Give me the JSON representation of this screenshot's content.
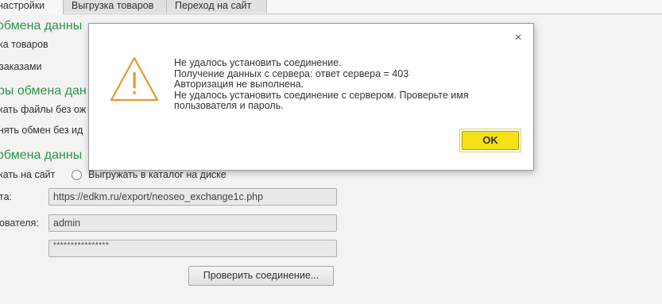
{
  "tabs": [
    {
      "label": "настройки"
    },
    {
      "label": "Выгрузка товаров"
    },
    {
      "label": "Переход на сайт"
    }
  ],
  "background": {
    "section1_title": "обмена данны",
    "section1_item1": "ка товаров",
    "section1_item2": "заказами",
    "section2_title": "ры обмена дан",
    "section2_item1": "кать файлы без ож",
    "section2_item2": "нять обмен без ид",
    "section3_title": "обмена данны",
    "radio_site_label": "кать на сайт",
    "radio_disk_label": "Выгружать в каталог на диске",
    "url_label": "та:",
    "url_value": "https://edkm.ru/export/neoseo_exchange1c.php",
    "user_label": "ователя:",
    "user_value": "admin",
    "password_value": "****************",
    "check_button": "Проверить соединение..."
  },
  "dialog": {
    "close_symbol": "×",
    "lines": [
      "Не удалось установить соединение.",
      "Получение данных с сервера: ответ сервера = 403",
      "Авторизация не выполнена.",
      "Не удалось установить соединение с сервером. Проверьте имя",
      "пользователя и пароль."
    ],
    "ok_label": "OK",
    "icon": "warning-triangle-icon"
  },
  "colors": {
    "section_title": "#2e9a4b",
    "warning_icon": "#e39a2c",
    "ok_button": "#f5e114"
  }
}
